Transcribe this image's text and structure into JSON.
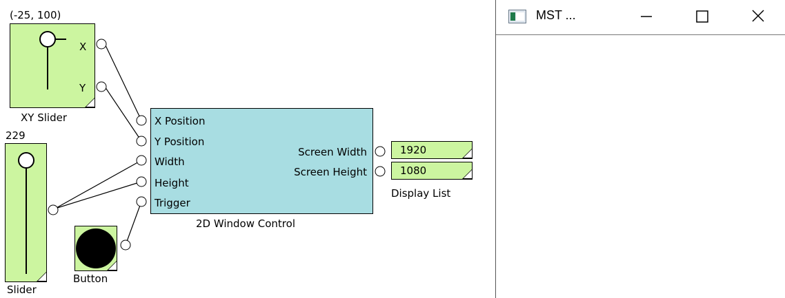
{
  "xy_slider": {
    "readout": "(-25, 100)",
    "x_label": "X",
    "y_label": "Y",
    "name": "XY Slider"
  },
  "slider": {
    "readout": "229",
    "name": "Slider"
  },
  "button": {
    "name": "Button"
  },
  "window_control": {
    "name": "2D Window Control",
    "inputs": [
      "X Position",
      "Y Position",
      "Width",
      "Height",
      "Trigger"
    ],
    "outputs": [
      "Screen Width",
      "Screen Height"
    ]
  },
  "display_list": {
    "name": "Display List",
    "values": [
      "1920",
      "1080"
    ]
  },
  "window": {
    "title": "MST ...",
    "minimize_glyph": "—",
    "maximize_glyph": "☐",
    "close_glyph": "✕"
  },
  "colors": {
    "block_green": "#ccf5a0",
    "block_cyan": "#a8dde2"
  }
}
